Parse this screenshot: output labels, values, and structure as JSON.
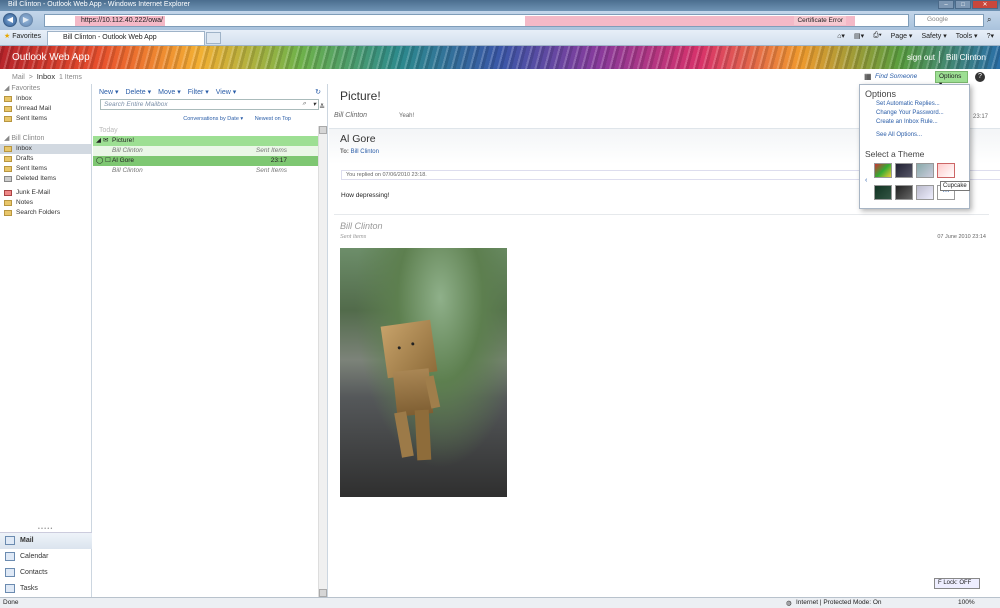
{
  "window": {
    "title": "Bill Clinton - Outlook Web App - Windows Internet Explorer"
  },
  "browser": {
    "address": "https://10.112.40.222/owa/",
    "cert_error": "Certificate Error",
    "search_placeholder": "Google",
    "favorites_label": "Favorites",
    "tab_label": "Bill Clinton - Outlook Web App",
    "commands": [
      "Page ▾",
      "Safety ▾",
      "Tools ▾"
    ]
  },
  "banner": {
    "logo": "Outlook Web App",
    "sign_out": "sign out",
    "user": "Bill Clinton"
  },
  "breadcrumb": {
    "mail": "Mail",
    "sep": ">",
    "folder": "Inbox",
    "count": "1 Items"
  },
  "favorites": {
    "header": "Favorites",
    "items": [
      "Inbox",
      "Unread Mail",
      "Sent Items"
    ]
  },
  "mailbox": {
    "header": "Bill Clinton",
    "items": [
      "Inbox",
      "Drafts",
      "Sent Items",
      "Deleted Items",
      "Junk E-Mail",
      "Notes",
      "Search Folders"
    ]
  },
  "nav": {
    "items": [
      "Mail",
      "Calendar",
      "Contacts",
      "Tasks"
    ],
    "dots": "• • • • •"
  },
  "list_toolbar": {
    "new": "New ▾",
    "delete": "Delete ▾",
    "move": "Move ▾",
    "filter": "Filter ▾",
    "view": "View ▾"
  },
  "search": {
    "placeholder": "Search Entire Mailbox"
  },
  "sort": {
    "by": "Conversations by Date ▾",
    "order": "Newest on Top"
  },
  "group": {
    "label": "Today"
  },
  "messages": [
    {
      "subject": "Picture!",
      "from": "Bill Clinton",
      "folder": "Sent Items"
    },
    {
      "subject": "Al Gore",
      "time": "23:17",
      "from": "Bill Clinton",
      "folder": "Sent Items"
    }
  ],
  "reading": {
    "subject": "Picture!",
    "first_from": "Bill Clinton",
    "first_preview": "Yeah!",
    "first_time": "23:17",
    "item_name": "Al Gore",
    "to_label": "To:",
    "to_value": "Bill Clinton",
    "replied": "You replied on 07/06/2010 23:18.",
    "body": "How depressing!",
    "second_from": "Bill Clinton",
    "second_folder": "Sent Items",
    "second_date": "07 June 2010 23:14",
    "right_time": "23:17"
  },
  "topbar": {
    "find": "Find Someone",
    "options": "Options ▾",
    "help": "?"
  },
  "options_menu": {
    "title": "Options",
    "links": [
      "Set Automatic Replies...",
      "Change Your Password...",
      "Create an Inbox Rule...",
      "See All Options..."
    ],
    "theme_title": "Select a Theme",
    "tooltip": "Cupcake",
    "more": "..."
  },
  "flock": "F Lock: OFF",
  "status": {
    "left": "Done",
    "zone": "Internet | Protected Mode: On",
    "zoom": "100%"
  },
  "colors": {
    "selection": "#9ddf93",
    "link": "#2a5da8"
  }
}
